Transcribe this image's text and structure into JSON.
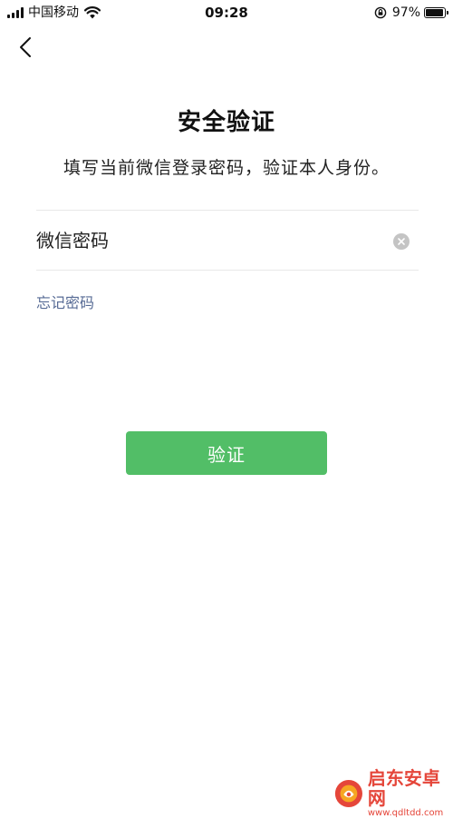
{
  "status_bar": {
    "carrier": "中国移动",
    "time": "09:28",
    "battery_percent": "97%",
    "battery_level": 0.97
  },
  "header": {
    "back_icon": "chevron-left-icon"
  },
  "main": {
    "title": "安全验证",
    "subtitle": "填写当前微信登录密码，验证本人身份。",
    "password_placeholder": "微信密码",
    "password_value": "",
    "clear_icon": "clear-circle-icon",
    "forgot_label": "忘记密码",
    "verify_label": "验证"
  },
  "watermark": {
    "title": "启东安卓网",
    "url": "www.qdltdd.com"
  },
  "colors": {
    "accent_green": "#52be67",
    "link_blue": "#576b95",
    "watermark_red": "#e5463a"
  }
}
